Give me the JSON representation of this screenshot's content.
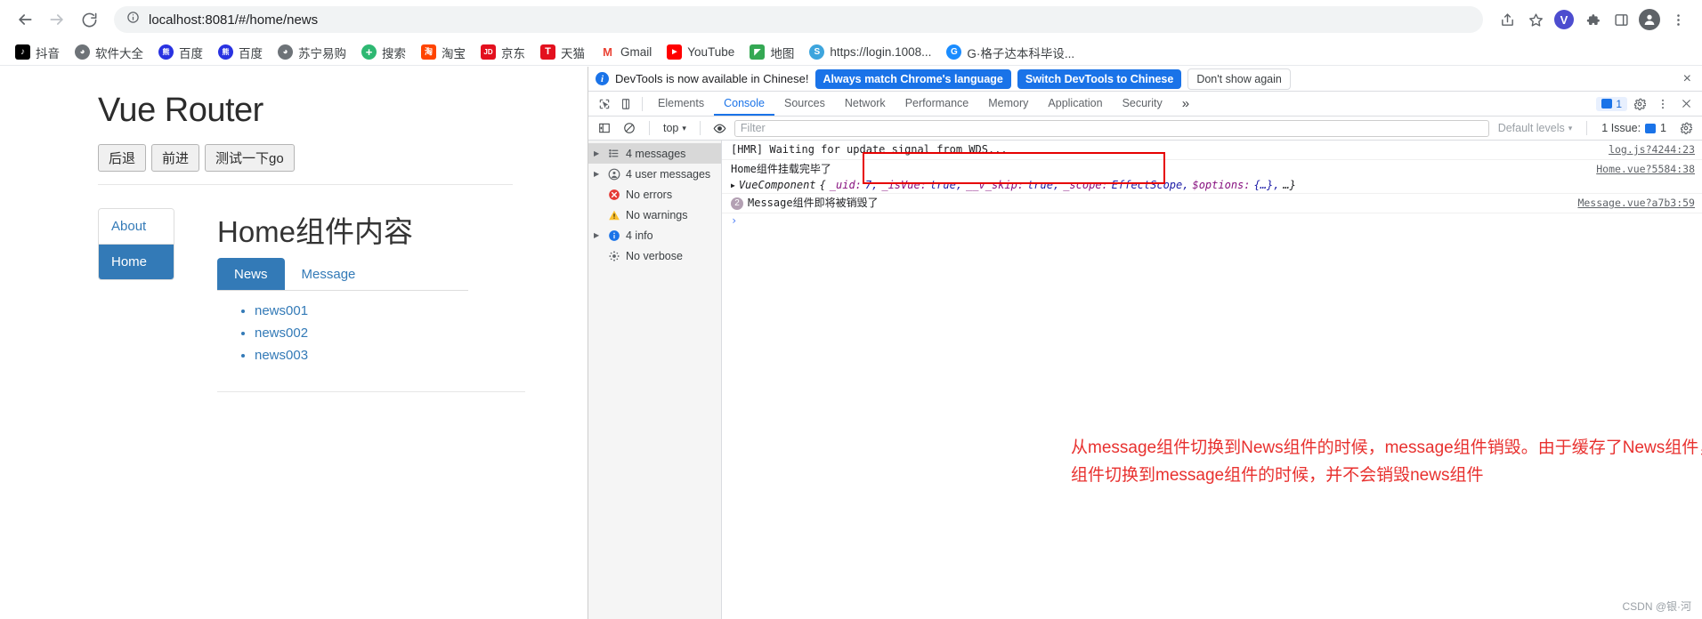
{
  "browser": {
    "nav": {
      "back": "back-arrow",
      "forward": "forward-arrow",
      "reload": "reload",
      "info": "site-info"
    },
    "url_prefix": "localhost",
    "url_rest": ":8081/#/home/news",
    "url_full": "localhost:8081/#/home/news",
    "right_icons": [
      "share-icon",
      "bookmark-star-icon",
      "profile-v-avatar",
      "extensions-puzzle-icon",
      "side-panel-icon",
      "account-icon",
      "more-menu-icon"
    ],
    "avatar_letter": "V"
  },
  "bookmarks": [
    {
      "label": "抖音",
      "icon_char": "♪",
      "bg": "#000000",
      "shape": "rounded"
    },
    {
      "label": "软件大全",
      "icon_char": "◕",
      "bg": "#6e7378",
      "shape": "circle"
    },
    {
      "label": "百度",
      "icon_char": "熊",
      "bg": "#2932e1",
      "shape": "circle"
    },
    {
      "label": "百度",
      "icon_char": "熊",
      "bg": "#2932e1",
      "shape": "circle"
    },
    {
      "label": "苏宁易购",
      "icon_char": "◕",
      "bg": "#6e7378",
      "shape": "circle"
    },
    {
      "label": "搜索",
      "icon_char": "+",
      "bg": "#2eb872",
      "shape": "circle"
    },
    {
      "label": "淘宝",
      "icon_char": "淘",
      "bg": "#ff4400",
      "shape": "rounded"
    },
    {
      "label": "京东",
      "icon_char": "JD",
      "bg": "#e3101e",
      "shape": "rounded"
    },
    {
      "label": "天猫",
      "icon_char": "T",
      "bg": "#e3101e",
      "shape": "rounded"
    },
    {
      "label": "Gmail",
      "icon_char": "M",
      "bg": "#ffffff",
      "fg": "#ea4335",
      "shape": "plain"
    },
    {
      "label": "YouTube",
      "icon_char": "▶",
      "bg": "#ff0000",
      "shape": "rounded"
    },
    {
      "label": "地图",
      "icon_char": "◤",
      "bg": "#34a853",
      "shape": "rounded"
    },
    {
      "label": "https://login.1008...",
      "icon_char": "S",
      "bg": "#3da5dd",
      "shape": "circle"
    },
    {
      "label": "G·格子达本科毕设...",
      "icon_char": "G",
      "bg": "#1a8cff",
      "shape": "circle"
    }
  ],
  "app": {
    "title": "Vue Router",
    "buttons": [
      {
        "label": "后退"
      },
      {
        "label": "前进"
      },
      {
        "label": "测试一下go"
      }
    ],
    "nav_items": [
      {
        "label": "About",
        "active": false
      },
      {
        "label": "Home",
        "active": true
      }
    ],
    "content_heading": "Home组件内容",
    "tabs": [
      {
        "label": "News",
        "active": true
      },
      {
        "label": "Message",
        "active": false
      }
    ],
    "news_items": [
      "news001",
      "news002",
      "news003"
    ]
  },
  "devtools": {
    "notice": {
      "icon": "info-icon",
      "text": "DevTools is now available in Chinese!",
      "primary_btn": "Always match Chrome's language",
      "secondary_btn": "Switch DevTools to Chinese",
      "dismiss_btn": "Don't show again",
      "close": "×"
    },
    "tabs": [
      {
        "label": "Elements",
        "active": false
      },
      {
        "label": "Console",
        "active": true
      },
      {
        "label": "Sources",
        "active": false
      },
      {
        "label": "Network",
        "active": false
      },
      {
        "label": "Performance",
        "active": false
      },
      {
        "label": "Memory",
        "active": false
      },
      {
        "label": "Application",
        "active": false
      },
      {
        "label": "Security",
        "active": false
      }
    ],
    "tabs_overflow": "»",
    "tabbar_right": {
      "message_count": "1",
      "settings": "gear-icon",
      "more": "more-vertical-icon",
      "close": "close-icon"
    },
    "toolbar": {
      "sidebar_toggle": "console-sidebar-icon",
      "clear": "clear-console-icon",
      "context": "top",
      "context_caret": "▾",
      "eye": "live-expression-icon",
      "filter_placeholder": "Filter",
      "levels": "Default levels",
      "levels_caret": "▾",
      "issues": "1 Issue:",
      "issues_count": "1",
      "settings": "gear-icon"
    },
    "sidebar": [
      {
        "label": "4 messages",
        "icon": "list-icon",
        "arrow": true,
        "selected": true
      },
      {
        "label": "4 user messages",
        "icon": "user-icon",
        "arrow": true,
        "selected": false
      },
      {
        "label": "No errors",
        "icon": "error-icon",
        "arrow": false,
        "selected": false
      },
      {
        "label": "No warnings",
        "icon": "warning-icon",
        "arrow": false,
        "selected": false
      },
      {
        "label": "4 info",
        "icon": "info-icon",
        "arrow": true,
        "selected": false
      },
      {
        "label": "No verbose",
        "icon": "verbose-icon",
        "arrow": false,
        "selected": false
      }
    ],
    "logs": [
      {
        "text": "[HMR] Waiting for update signal from WDS...",
        "source": "log.js?4244:23"
      },
      {
        "text": "Home组件挂载完毕了",
        "source": "Home.vue?5584:38"
      }
    ],
    "log_object": {
      "arrow": "▶",
      "ctor": "VueComponent",
      "open": "{",
      "parts": [
        {
          "k": "_uid:",
          "v": "7,"
        },
        {
          "k": "_isVue:",
          "v": "true,"
        },
        {
          "k": "__v_skip:",
          "v": "true,"
        },
        {
          "k": "_scope:",
          "v": "EffectScope,"
        },
        {
          "k": "$options:",
          "v": "{…},"
        }
      ],
      "tail": "…}"
    },
    "highlighted_log": {
      "badge": "2",
      "text": "Message组件即将被销毁了",
      "source": "Message.vue?a7b3:59"
    },
    "prompt": "›"
  },
  "annotation": {
    "text": "从message组件切换到News组件的时候，message组件销毁。由于缓存了News组件，从news组件切换到message组件的时候，并不会销毁news组件",
    "color": "#e8312f"
  },
  "watermark": "CSDN @银·河"
}
